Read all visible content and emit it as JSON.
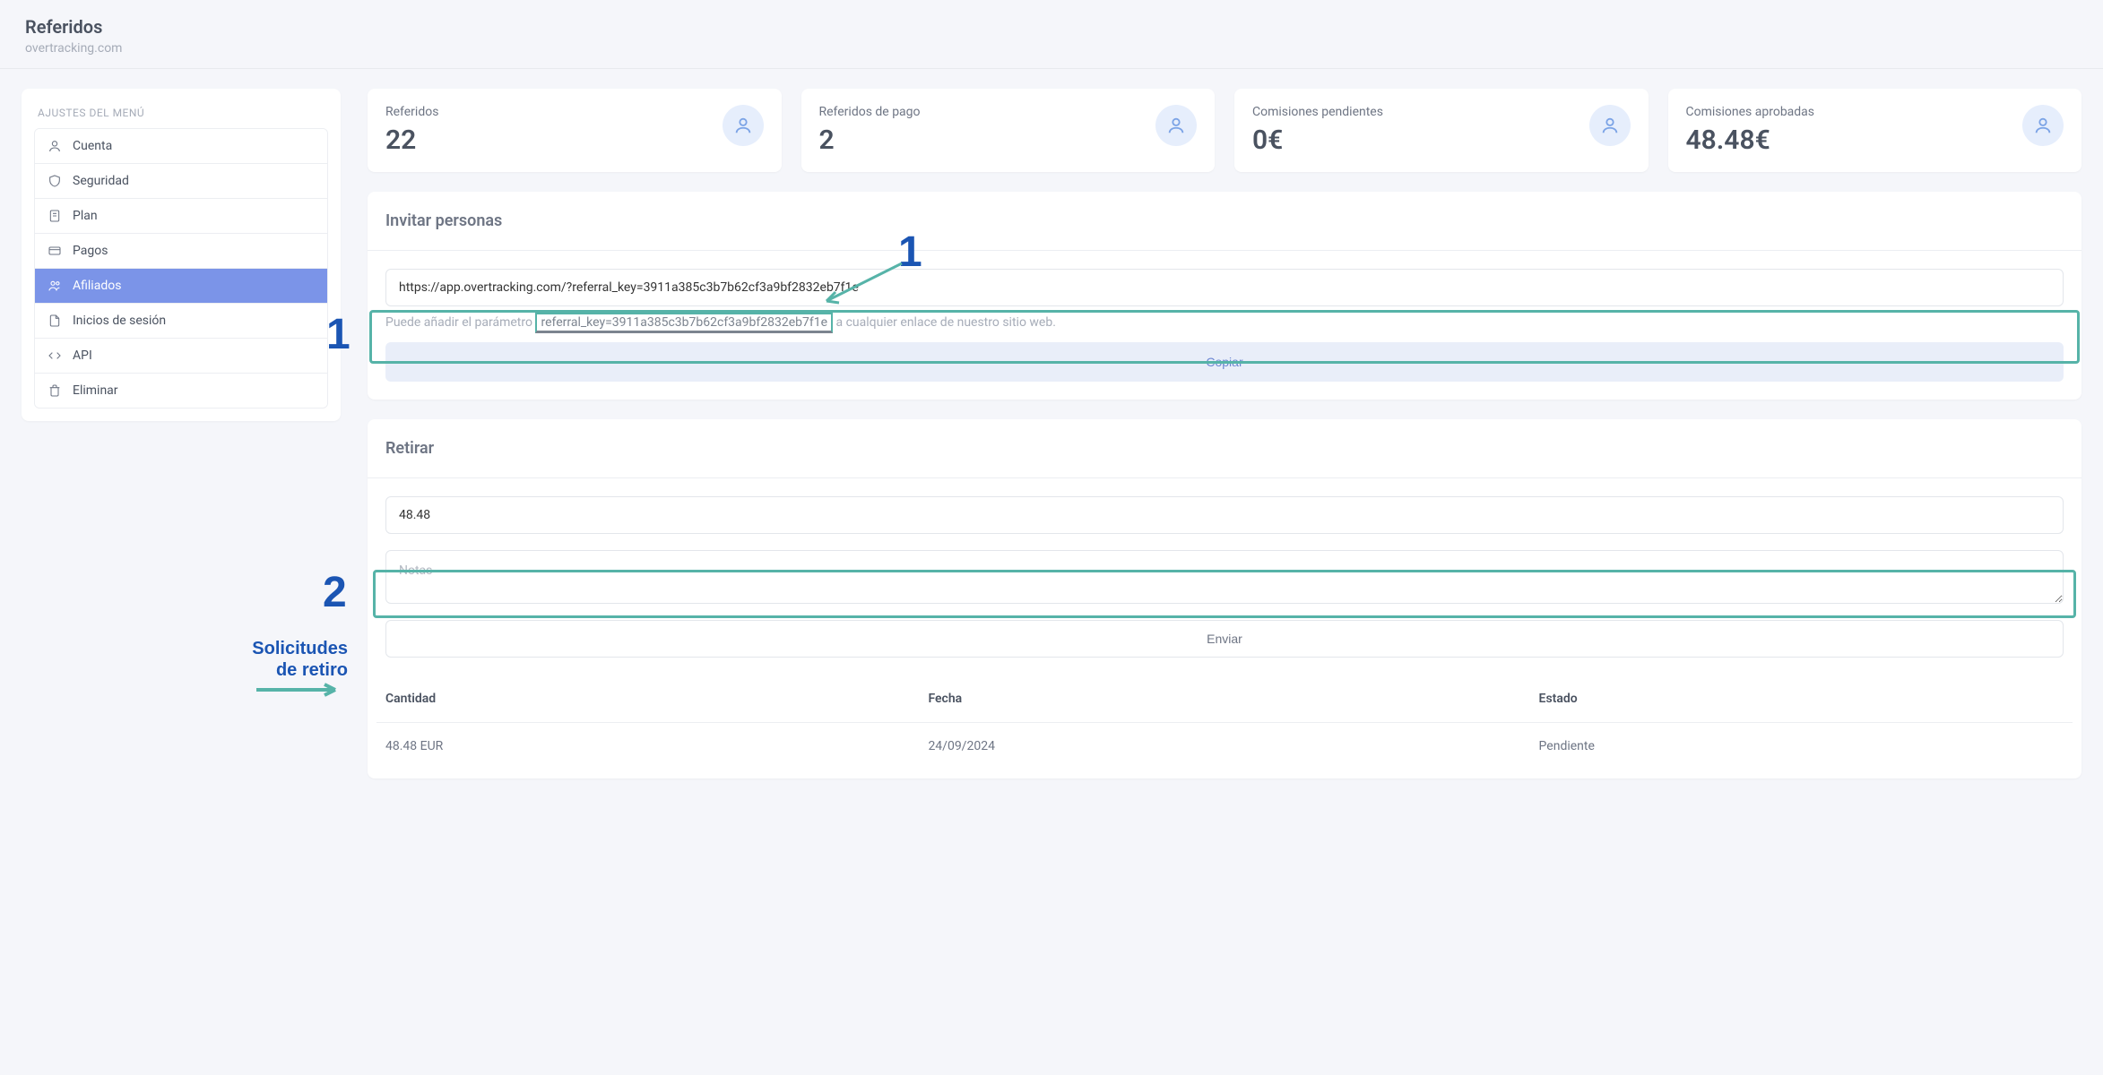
{
  "header": {
    "title": "Referidos",
    "subtitle": "overtracking.com"
  },
  "sidebar": {
    "heading": "AJUSTES DEL MENÚ",
    "items": [
      {
        "label": "Cuenta",
        "icon": "user-icon",
        "active": false
      },
      {
        "label": "Seguridad",
        "icon": "shield-icon",
        "active": false
      },
      {
        "label": "Plan",
        "icon": "file-icon",
        "active": false
      },
      {
        "label": "Pagos",
        "icon": "card-icon",
        "active": false
      },
      {
        "label": "Afiliados",
        "icon": "users-icon",
        "active": true
      },
      {
        "label": "Inicios de sesión",
        "icon": "document-icon",
        "active": false
      },
      {
        "label": "API",
        "icon": "code-icon",
        "active": false
      },
      {
        "label": "Eliminar",
        "icon": "trash-icon",
        "active": false
      }
    ]
  },
  "stats": [
    {
      "label": "Referidos",
      "value": "22"
    },
    {
      "label": "Referidos de pago",
      "value": "2"
    },
    {
      "label": "Comisiones pendientes",
      "value": "0€"
    },
    {
      "label": "Comisiones aprobadas",
      "value": "48.48€"
    }
  ],
  "invite": {
    "title": "Invitar personas",
    "link": "https://app.overtracking.com/?referral_key=3911a385c3b7b62cf3a9bf2832eb7f1e",
    "helper_pre": "Puede añadir el parámetro ",
    "helper_code": "referral_key=3911a385c3b7b62cf3a9bf2832eb7f1e",
    "helper_post": " a cualquier enlace de nuestro sitio web.",
    "copy_label": "Copiar"
  },
  "withdraw": {
    "title": "Retirar",
    "amount_value": "48.48",
    "notes_placeholder": "Notas",
    "submit_label": "Enviar"
  },
  "requests": {
    "columns": {
      "amount": "Cantidad",
      "date": "Fecha",
      "status": "Estado"
    },
    "rows": [
      {
        "amount": "48.48 EUR",
        "date": "24/09/2024",
        "status": "Pendiente"
      }
    ]
  },
  "annotations": {
    "num1": "1",
    "num1_top": "1",
    "num2": "2",
    "solicitudes": "Solicitudes\nde retiro"
  }
}
